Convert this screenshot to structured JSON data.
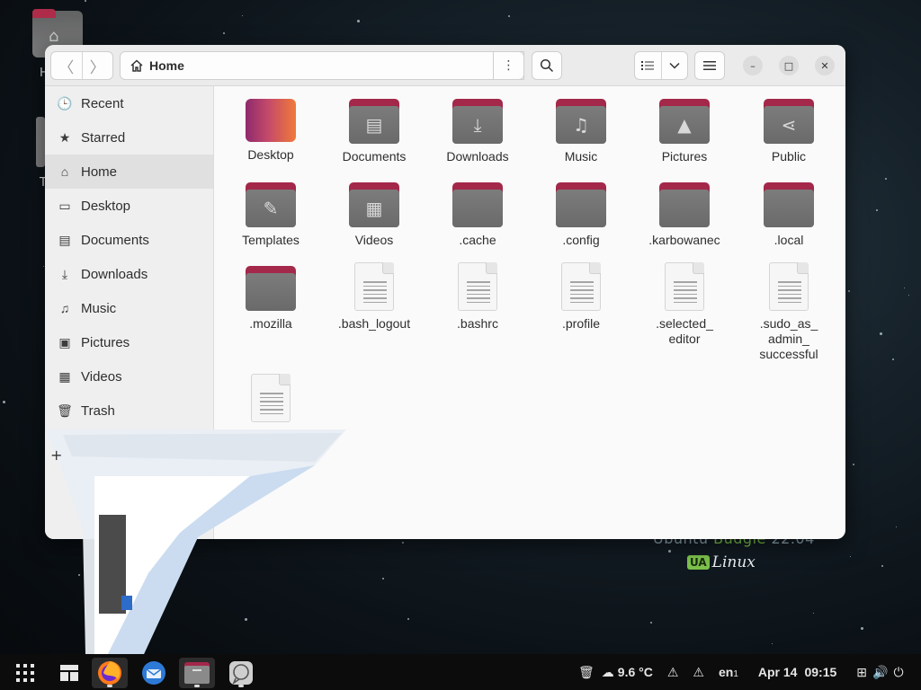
{
  "desktop": {
    "brand_line": "Ubuntu",
    "brand_accent": "Budgie",
    "brand_version": "22.04",
    "ua_badge": "UA",
    "ua_text": "Linux"
  },
  "window": {
    "path_label": "Home",
    "controls": {
      "minimize": "–",
      "maximize": "□",
      "close": "✕"
    }
  },
  "sidebar": {
    "items": [
      {
        "label": "Recent",
        "icon": "clock-icon"
      },
      {
        "label": "Starred",
        "icon": "star-icon"
      },
      {
        "label": "Home",
        "icon": "home-icon",
        "active": true
      },
      {
        "label": "Desktop",
        "icon": "desktop-icon"
      },
      {
        "label": "Documents",
        "icon": "document-icon"
      },
      {
        "label": "Downloads",
        "icon": "download-icon"
      },
      {
        "label": "Music",
        "icon": "music-icon"
      },
      {
        "label": "Pictures",
        "icon": "picture-icon"
      },
      {
        "label": "Videos",
        "icon": "video-icon"
      },
      {
        "label": "Trash",
        "icon": "trash-icon"
      }
    ]
  },
  "files": [
    {
      "label": "Desktop",
      "kind": "desktop-folder"
    },
    {
      "label": "Documents",
      "kind": "folder",
      "glyph": "document"
    },
    {
      "label": "Downloads",
      "kind": "folder",
      "glyph": "download"
    },
    {
      "label": "Music",
      "kind": "folder",
      "glyph": "music"
    },
    {
      "label": "Pictures",
      "kind": "folder",
      "glyph": "picture"
    },
    {
      "label": "Public",
      "kind": "folder",
      "glyph": "share"
    },
    {
      "label": "Templates",
      "kind": "folder",
      "glyph": "template"
    },
    {
      "label": "Videos",
      "kind": "folder",
      "glyph": "video"
    },
    {
      "label": ".cache",
      "kind": "folder"
    },
    {
      "label": ".config",
      "kind": "folder"
    },
    {
      "label": ".karbowanec",
      "kind": "folder"
    },
    {
      "label": ".local",
      "kind": "folder"
    },
    {
      "label": ".mozilla",
      "kind": "folder"
    },
    {
      "label": ".bash_logout",
      "kind": "text"
    },
    {
      "label": ".bashrc",
      "kind": "text"
    },
    {
      "label": ".profile",
      "kind": "text"
    },
    {
      "label": ".selected_\neditor",
      "kind": "text"
    },
    {
      "label": ".sudo_as_\nadmin_\nsuccessful",
      "kind": "text"
    },
    {
      "label": "",
      "kind": "text"
    }
  ],
  "taskbar": {
    "weather": "9.6 °C",
    "keyboard": "en",
    "keyboard_sub": "1",
    "date": "Apr 14",
    "time": "09:15"
  }
}
